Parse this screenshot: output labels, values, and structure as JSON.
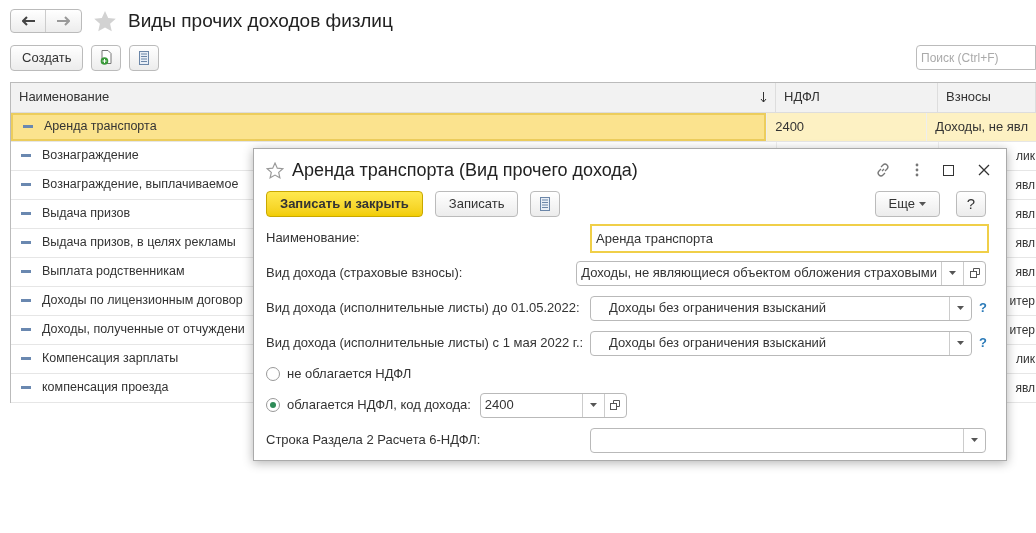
{
  "page": {
    "title": "Виды прочих доходов физлиц",
    "create_button": "Создать",
    "search": {
      "placeholder": "Поиск (Ctrl+F)"
    }
  },
  "table": {
    "columns": [
      {
        "label": "Наименование",
        "sorted": true
      },
      {
        "label": "НДФЛ",
        "sorted": false
      },
      {
        "label": "Взносы",
        "sorted": false
      }
    ],
    "rows": [
      {
        "name": "Аренда транспорта",
        "ndfl": "2400",
        "contrib": "Доходы, не явл",
        "selected": true
      },
      {
        "name": "Вознаграждение",
        "contrib": "лик",
        "selected": false
      },
      {
        "name": "Вознаграждение, выплачиваемое",
        "contrib": "явл",
        "selected": false
      },
      {
        "name": "Выдача призов",
        "contrib": "явл",
        "selected": false
      },
      {
        "name": "Выдача призов, в целях рекламы",
        "contrib": "явл",
        "selected": false
      },
      {
        "name": "Выплата родственникам",
        "contrib": "явл",
        "selected": false
      },
      {
        "name": "Доходы по лицензионным договор",
        "contrib": "итер",
        "selected": false
      },
      {
        "name": "Доходы, полученные от отчуждени",
        "contrib": "итер",
        "selected": false
      },
      {
        "name": "Компенсация зарплаты",
        "contrib": "лик",
        "selected": false
      },
      {
        "name": "компенсация проезда",
        "contrib": "явл",
        "selected": false
      }
    ]
  },
  "dialog": {
    "title": "Аренда транспорта (Вид прочего дохода)",
    "save_close_button": "Записать и закрыть",
    "save_button": "Записать",
    "more_button": "Еще",
    "help_button": "?",
    "fields": [
      {
        "kind": "text",
        "label": "Наименование:",
        "value": "Аренда транспорта",
        "focused": true
      },
      {
        "kind": "select",
        "label": "Вид дохода (страховые взносы):",
        "value": "Доходы, не являющиеся объектом обложения страховыми",
        "open_button": true
      },
      {
        "kind": "select",
        "label": "Вид дохода (исполнительные листы) до 01.05.2022:",
        "value": "Доходы без ограничения взысканий",
        "help": "?"
      },
      {
        "kind": "select",
        "label": "Вид дохода (исполнительные листы) с 1 мая 2022 г.:",
        "value": "Доходы без ограничения взысканий",
        "help": "?"
      }
    ],
    "radios": [
      {
        "label": "не облагается НДФЛ",
        "selected": false
      },
      {
        "label": "облагается НДФЛ, код дохода:",
        "selected": true,
        "code": "2400"
      }
    ],
    "last_field": {
      "label": "Строка Раздела 2 Расчета 6-НДФЛ:"
    }
  }
}
